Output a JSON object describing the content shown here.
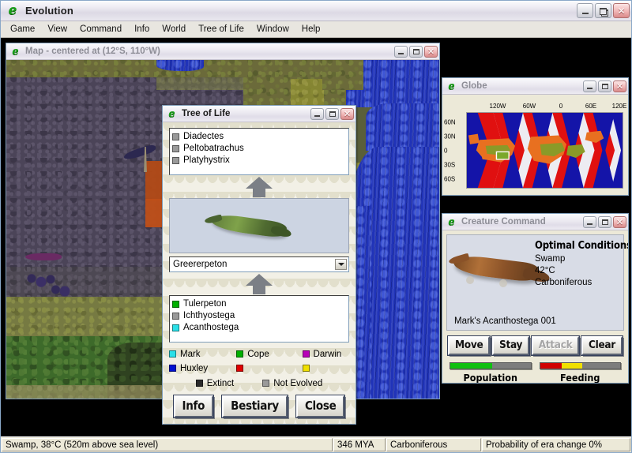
{
  "app": {
    "title": "Evolution",
    "icon": "evolution-e-icon",
    "window_controls": {
      "minimize": "_",
      "restore": "❐",
      "close": "✕"
    },
    "menu": [
      "Game",
      "View",
      "Command",
      "Info",
      "World",
      "Tree of Life",
      "Window",
      "Help"
    ]
  },
  "map_window": {
    "title": "Map - centered at (12°S, 110°W)",
    "icon": "evolution-e-icon"
  },
  "tree_of_life": {
    "title": "Tree of Life",
    "icon": "evolution-e-icon",
    "ancestors": [
      {
        "name": "Diadectes",
        "color": "#9a9a9a"
      },
      {
        "name": "Peltobatrachus",
        "color": "#9a9a9a"
      },
      {
        "name": "Platyhystrix",
        "color": "#9a9a9a"
      }
    ],
    "selected_species": "Greererpeton",
    "descendants": [
      {
        "name": "Tulerpeton",
        "color": "#00b000"
      },
      {
        "name": "Ichthyostega",
        "color": "#9a9a9a"
      },
      {
        "name": "Acanthostega",
        "color": "#2ae0e8"
      }
    ],
    "legend": [
      {
        "label": "Mark",
        "color": "#2ae0e8"
      },
      {
        "label": "Cope",
        "color": "#00b000"
      },
      {
        "label": "Darwin",
        "color": "#b800b8"
      },
      {
        "label": "Huxley",
        "color": "#0010d0"
      },
      {
        "label": "",
        "color": "#e00000"
      },
      {
        "label": "",
        "color": "#f0e000"
      }
    ],
    "status_legend": [
      {
        "label": "Extinct",
        "color": "#2a2a2a"
      },
      {
        "label": "Not Evolved",
        "color": "#9a9a9a"
      }
    ],
    "buttons": [
      "Info",
      "Bestiary",
      "Close"
    ]
  },
  "globe": {
    "title": "Globe",
    "icon": "evolution-e-icon",
    "lon_labels": [
      "120W",
      "60W",
      "0",
      "60E",
      "120E"
    ],
    "lat_labels": [
      "60N",
      "30N",
      "0",
      "30S",
      "60S"
    ],
    "colors": {
      "ocean": "#1414a8",
      "hot": "#e01010",
      "warm": "#e87020",
      "temperate": "#8a9a28",
      "background": "#edecf2",
      "viewport": "#7aa82a"
    }
  },
  "creature_command": {
    "title": "Creature Command",
    "icon": "evolution-e-icon",
    "optimal_heading": "Optimal Conditions",
    "optimal": [
      "Swamp",
      "42°C",
      "Carboniferous"
    ],
    "creature_name": "Mark's Acanthostega 001",
    "actions": [
      {
        "label": "Move",
        "enabled": true
      },
      {
        "label": "Stay",
        "enabled": true
      },
      {
        "label": "Attack",
        "enabled": false
      },
      {
        "label": "Clear",
        "enabled": true
      }
    ],
    "bars": [
      {
        "label": "Population",
        "segments": [
          {
            "color": "#10c010",
            "pct": 52
          }
        ]
      },
      {
        "label": "Feeding",
        "segments": [
          {
            "color": "#d00000",
            "pct": 27
          },
          {
            "color": "#f0e000",
            "pct": 26
          }
        ]
      }
    ]
  },
  "status_bar": {
    "location": "Swamp, 38°C (520m above sea level)",
    "mya": "346 MYA",
    "era": "Carboniferous",
    "era_change": "Probability of era change 0%"
  }
}
